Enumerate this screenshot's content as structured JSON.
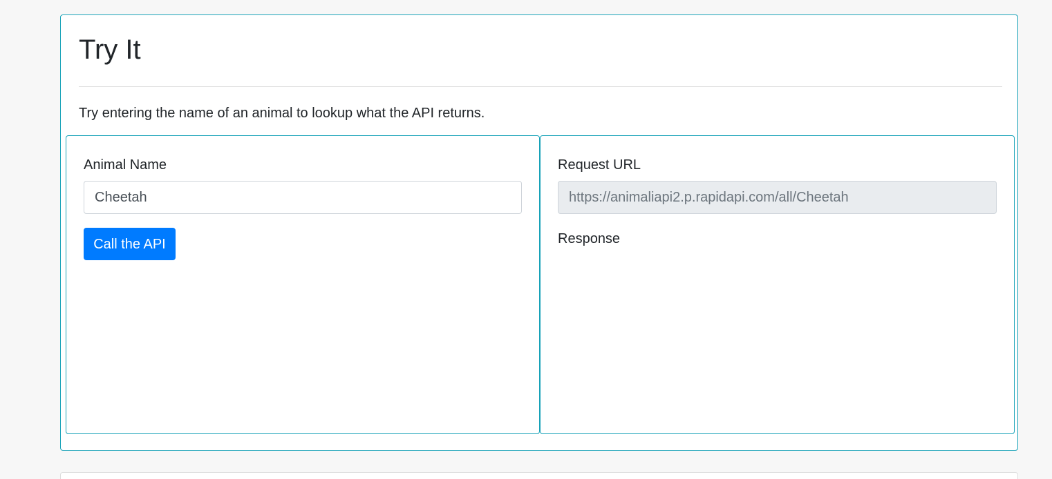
{
  "card": {
    "title": "Try It",
    "description": "Try entering the name of an animal to lookup what the API returns."
  },
  "form": {
    "animal_label": "Animal Name",
    "animal_value": "Cheetah",
    "submit_label": "Call the API"
  },
  "result": {
    "request_url_label": "Request URL",
    "request_url_value": "https://animaliapi2.p.rapidapi.com/all/Cheetah",
    "response_label": "Response",
    "response_body": ""
  },
  "colors": {
    "page_background": "#f7f7f7",
    "card_border": "#17a2b8",
    "primary_button": "#007bff",
    "readonly_input_background": "#e9ecef"
  }
}
